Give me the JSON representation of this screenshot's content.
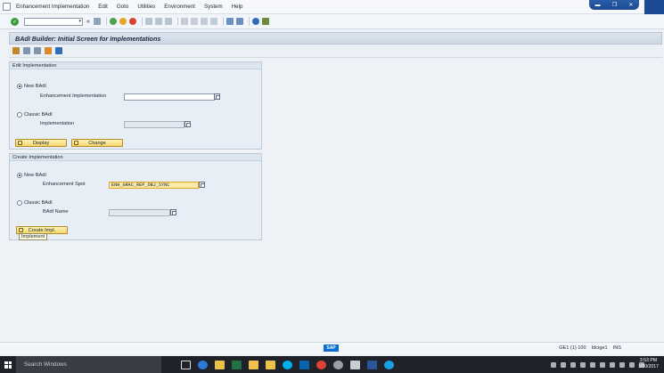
{
  "menu": {
    "items": [
      "Enhancement Implementation",
      "Edit",
      "Goto",
      "Utilities",
      "Environment",
      "System",
      "Help"
    ]
  },
  "window_controls": [
    "minimize-icon",
    "restore-icon",
    "close-icon"
  ],
  "toolbar": {
    "command_value": "",
    "nav_back_glyph": "«"
  },
  "title": "BAdI Builder: Initial Screen for Implementations",
  "edit_group": {
    "title": "Edit Implementation",
    "new_badi_label": "New BAdI",
    "new_badi_selected": true,
    "enh_impl_label": "Enhancement Implementation",
    "enh_impl_value": "",
    "classic_badi_label": "Classic BAdI",
    "classic_badi_selected": false,
    "implementation_label": "Implementation",
    "implementation_value": "",
    "display_button": "Display",
    "change_button": "Change"
  },
  "create_group": {
    "title": "Create Implementation",
    "new_badi_label": "New BAdI",
    "new_badi_selected": true,
    "spot_label": "Enhancement Spot",
    "spot_value": "ENH_GRAC_REP_OBJ_SYNC",
    "classic_badi_label": "Classic BAdI",
    "classic_badi_selected": false,
    "badi_name_label": "BAdI Name",
    "badi_name_value": "",
    "create_button": "Create Impl.",
    "tooltip": "Implement"
  },
  "status": {
    "logo_text": "SAP",
    "system": "GE1 (1) 100",
    "user": "Idcige1",
    "mode": "INS"
  },
  "taskbar": {
    "search_placeholder": "Search Windows",
    "time": "3:53 PM",
    "date": "1/30/2017"
  }
}
